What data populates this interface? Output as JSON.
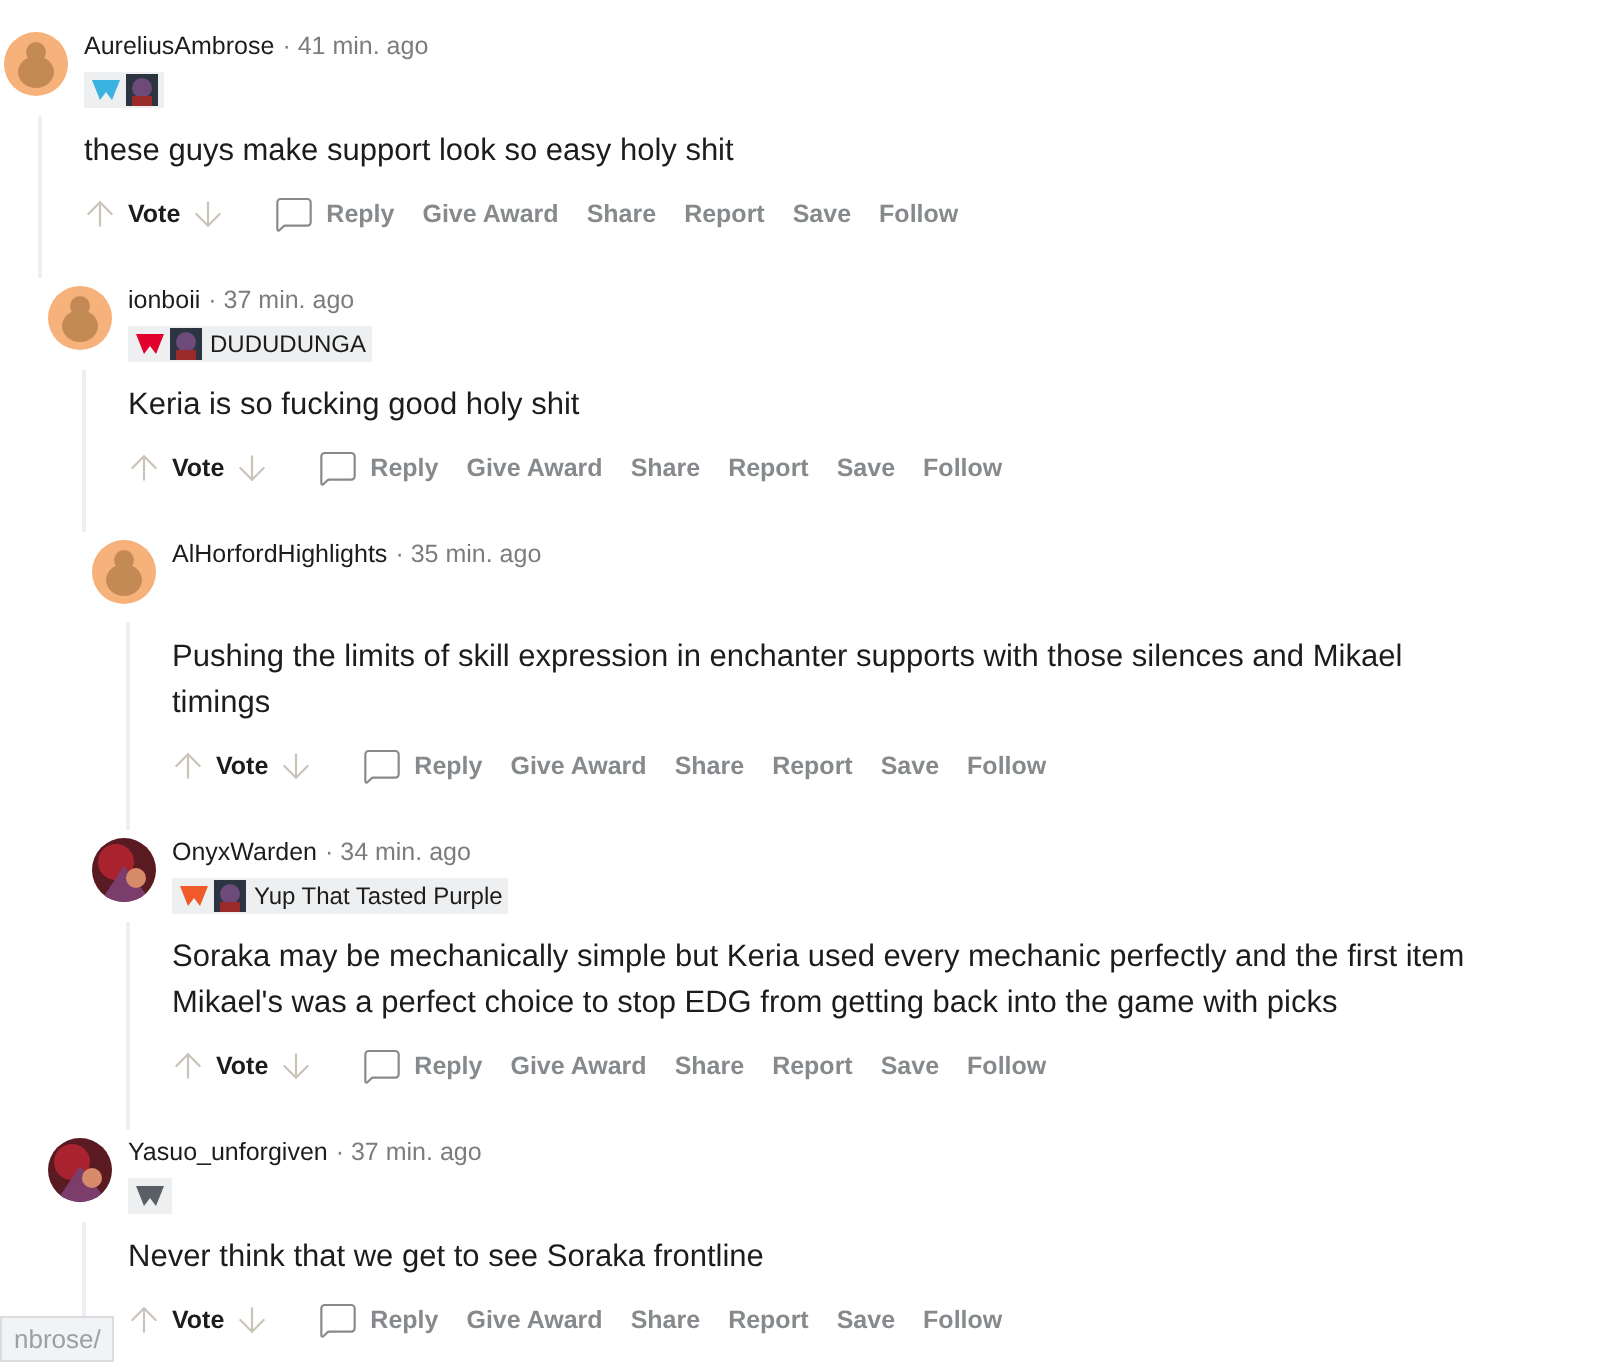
{
  "comments": [
    {
      "author": "AureliusAmbrose",
      "time": "· 41 min. ago",
      "avatar": {
        "kind": "snoo"
      },
      "flair": [
        {
          "kind": "emblem",
          "color": "#3ab3e0"
        },
        {
          "kind": "picture"
        }
      ],
      "body": "these guys make support look so easy holy shit",
      "vote": "Vote",
      "actions": [
        "Reply",
        "Give Award",
        "Share",
        "Report",
        "Save",
        "Follow"
      ],
      "children": [
        {
          "author": "ionboii",
          "time": "· 37 min. ago",
          "avatar": {
            "kind": "snoo"
          },
          "flair": [
            {
              "kind": "emblem",
              "color": "#e2012d"
            },
            {
              "kind": "picture"
            },
            {
              "kind": "text",
              "text": "DUDUDUNGA"
            }
          ],
          "body": "Keria is so fucking good holy shit",
          "vote": "Vote",
          "actions": [
            "Reply",
            "Give Award",
            "Share",
            "Report",
            "Save",
            "Follow"
          ],
          "children": [
            {
              "author": "AlHorfordHighlights",
              "time": "· 35 min. ago",
              "avatar": {
                "kind": "snoo"
              },
              "body": "Pushing the limits of skill expression in enchanter supports with those silences and Mikael timings",
              "vote": "Vote",
              "actions": [
                "Reply",
                "Give Award",
                "Share",
                "Report",
                "Save",
                "Follow"
              ]
            },
            {
              "author": "OnyxWarden",
              "time": "· 34 min. ago",
              "avatar": {
                "kind": "picture"
              },
              "flair": [
                {
                  "kind": "emblem",
                  "color": "#f05a28"
                },
                {
                  "kind": "picture"
                },
                {
                  "kind": "text",
                  "text": "Yup That Tasted Purple"
                }
              ],
              "body": "Soraka may be mechanically simple but Keria used every mechanic perfectly and the first item Mikael's was a perfect choice to stop EDG from getting back into the game with picks",
              "vote": "Vote",
              "actions": [
                "Reply",
                "Give Award",
                "Share",
                "Report",
                "Save",
                "Follow"
              ]
            }
          ]
        },
        {
          "author": "Yasuo_unforgiven",
          "time": "· 37 min. ago",
          "avatar": {
            "kind": "picture"
          },
          "flair": [
            {
              "kind": "emblem",
              "color": "#5a5f66"
            }
          ],
          "body": "Never think that we get to see Soraka frontline",
          "vote": "Vote",
          "actions": [
            "Reply",
            "Give Award",
            "Share",
            "Report",
            "Save",
            "Follow"
          ]
        }
      ]
    }
  ],
  "status_url": "nbrose/"
}
